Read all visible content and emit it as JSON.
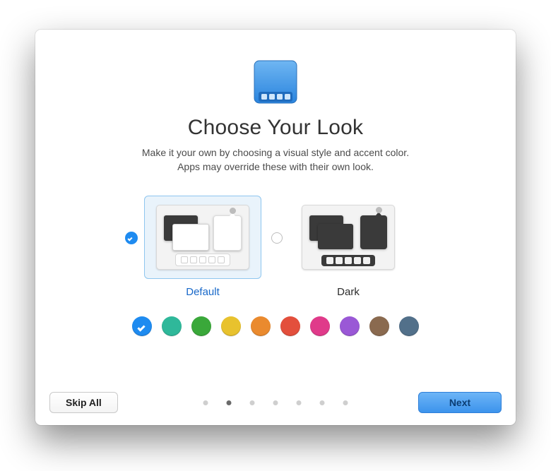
{
  "title": "Choose Your Look",
  "subtitle_line1": "Make it your own by choosing a visual style and accent color.",
  "subtitle_line2": "Apps may override these with their own look.",
  "themes": {
    "default_label": "Default",
    "dark_label": "Dark",
    "selected": "default"
  },
  "accent_colors": {
    "selected_index": 0,
    "values": [
      "#1e8bf0",
      "#2fb89a",
      "#3aa83a",
      "#e8c22e",
      "#ea8a2e",
      "#e34f3c",
      "#e03a8a",
      "#9a58d6",
      "#8a6a4f",
      "#52708a"
    ]
  },
  "pager": {
    "count": 7,
    "active_index": 1
  },
  "buttons": {
    "skip": "Skip All",
    "next": "Next"
  }
}
